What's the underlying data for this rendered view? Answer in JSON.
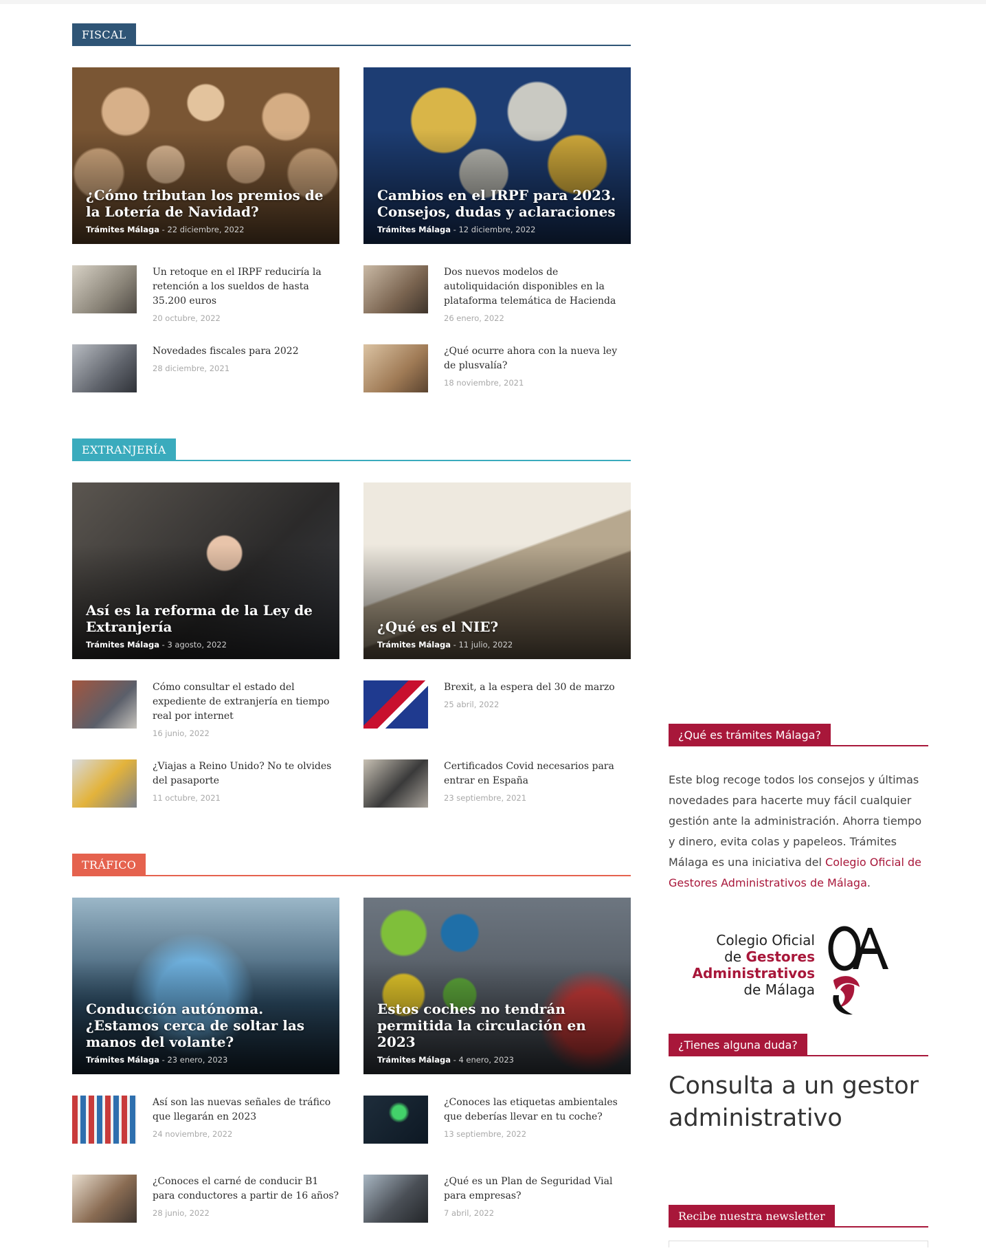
{
  "sections": [
    {
      "name": "FISCAL",
      "color": "#2f5576",
      "featured": [
        {
          "title": "¿Cómo tributan los premios de la Lotería de Navidad?",
          "author": "Trámites Málaga",
          "date": "22 diciembre, 2022"
        },
        {
          "title": "Cambios en el IRPF para 2023. Consejos, dudas y aclaraciones",
          "author": "Trámites Málaga",
          "date": "12 diciembre, 2022"
        }
      ],
      "items": [
        {
          "title": "Un retoque en el IRPF reduciría la retención a los sueldos de hasta 35.200 euros",
          "date": "20 octubre, 2022"
        },
        {
          "title": "Dos nuevos modelos de autoliquidación disponibles en la plataforma telemática de Hacienda",
          "date": "26 enero, 2022"
        },
        {
          "title": "Novedades fiscales para 2022",
          "date": "28 diciembre, 2021"
        },
        {
          "title": "¿Qué ocurre ahora con la nueva ley de plusvalía?",
          "date": "18 noviembre, 2021"
        }
      ]
    },
    {
      "name": "EXTRANJERÍA",
      "color": "#3aabbd",
      "featured": [
        {
          "title": "Así es la reforma de la Ley de Extranjería",
          "author": "Trámites Málaga",
          "date": "3 agosto, 2022"
        },
        {
          "title": "¿Qué es el NIE?",
          "author": "Trámites Málaga",
          "date": "11 julio, 2022"
        }
      ],
      "items": [
        {
          "title": "Cómo consultar el estado del expediente de extranjería en tiempo real por internet",
          "date": "16 junio, 2022"
        },
        {
          "title": "Brexit, a la espera del 30 de marzo",
          "date": "25 abril, 2022"
        },
        {
          "title": "¿Viajas a Reino Unido? No te olvides del pasaporte",
          "date": "11 octubre, 2021"
        },
        {
          "title": "Certificados Covid necesarios para entrar en España",
          "date": "23 septiembre, 2021"
        }
      ]
    },
    {
      "name": "TRÁFICO",
      "color": "#e5624e",
      "featured": [
        {
          "title": "Conducción autónoma. ¿Estamos cerca de soltar las manos del volante?",
          "author": "Trámites Málaga",
          "date": "23 enero, 2023"
        },
        {
          "title": "Estos coches no tendrán permitida la circulación en 2023",
          "author": "Trámites Málaga",
          "date": "4 enero, 2023"
        }
      ],
      "items": [
        {
          "title": "Así son las nuevas señales de tráfico que llegarán en 2023",
          "date": "24 noviembre, 2022"
        },
        {
          "title": "¿Conoces las etiquetas ambientales que deberías llevar en tu coche?",
          "date": "13 septiembre, 2022"
        },
        {
          "title": "¿Conoces el carné de conducir B1 para conductores a partir de 16 años?",
          "date": "28 junio, 2022"
        },
        {
          "title": "¿Qué es un Plan de Seguridad Vial para empresas?",
          "date": "7 abril, 2022"
        }
      ]
    }
  ],
  "sidebar": {
    "about_title": "¿Qué es trámites Málaga?",
    "about_text": "Este blog recoge todos los consejos y últimas novedades para hacerte muy fácil cualquier gestión ante la administración. Ahorra tiempo y dinero, evita colas y papeleos. Trámites Málaga es una iniciativa del ",
    "about_link": "Colegio Oficial de Gestores Administrativos de Málaga",
    "about_end": ".",
    "logo_line1": "Colegio Oficial",
    "logo_line2a": "de ",
    "logo_line2b": "Gestores",
    "logo_line3": "Administrativos",
    "logo_line4": "de Málaga",
    "doubt_title": "¿Tienes alguna duda?",
    "cta": "Consulta a un gestor administrativo",
    "newsletter_title": "Recibe nuestra newsletter",
    "accent": "#a8173a"
  }
}
